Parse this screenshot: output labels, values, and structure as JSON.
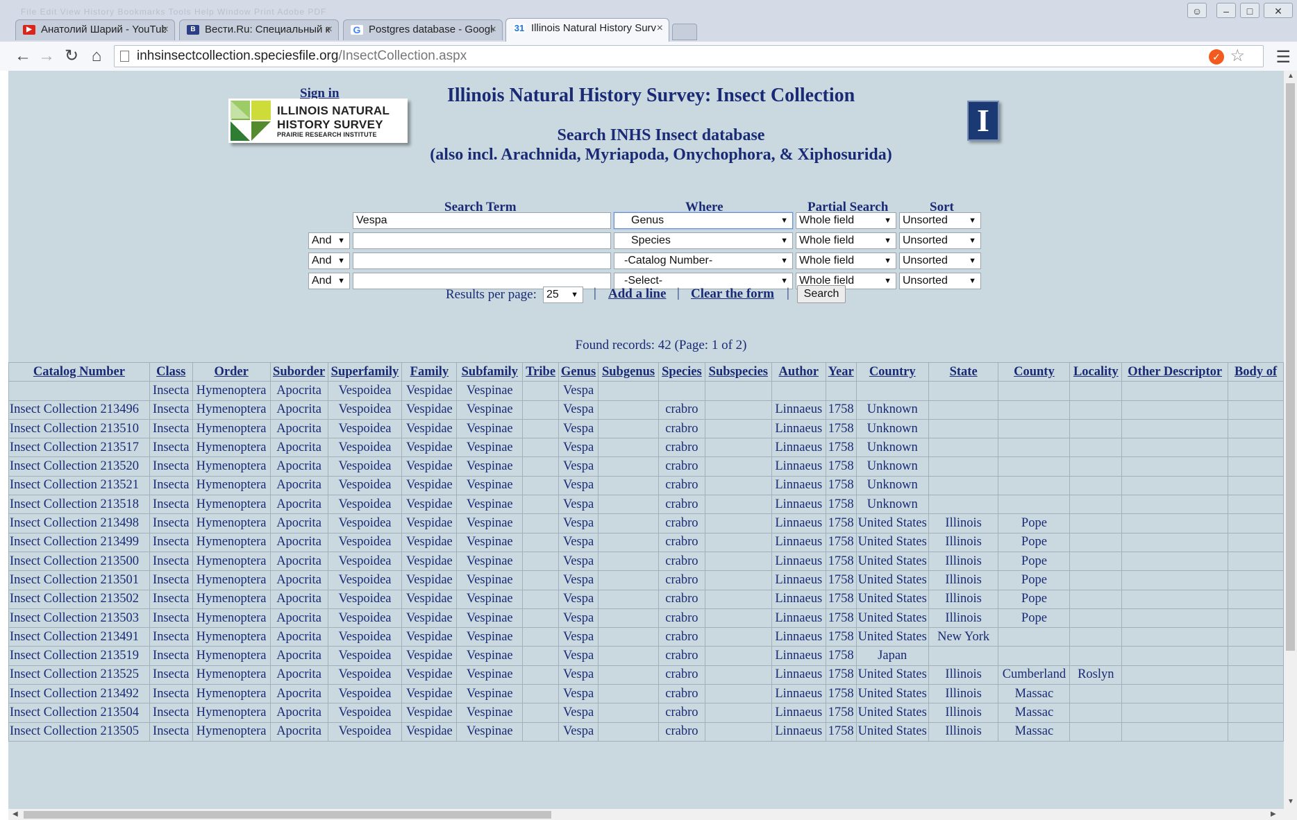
{
  "browser": {
    "menu_ghost": "File   Edit   View   History   Bookmarks   Tools   Help   Window   Print   Adobe PDF",
    "tabs": [
      {
        "title": "Анатолий Шарий - YouTube",
        "favicon": "youtube-icon",
        "color": "#d9251b"
      },
      {
        "title": "Вести.Ru: Специальный корреспондент",
        "favicon": "vesti-icon",
        "color": "#2b3e86"
      },
      {
        "title": "Postgres database - Google",
        "favicon": "google-icon",
        "color": "#4285f4"
      },
      {
        "title": "Illinois Natural History Survey",
        "favicon": "calendar-icon",
        "color": "#1a73e8"
      }
    ],
    "url_host": "inhsinsectcollection.speciesfile.org",
    "url_path": "/InsectCollection.aspx"
  },
  "page": {
    "sign_in": "Sign in",
    "title": "Illinois Natural History Survey: Insect Collection",
    "subtitle_line1": "Search INHS Insect database",
    "subtitle_line2": "(also incl. Arachnida, Myriapoda, Onychophora, & Xiphosurida)",
    "logo": {
      "line1": "ILLINOIS NATURAL",
      "line2": "HISTORY SURVEY",
      "line3": "PRAIRIE RESEARCH INSTITUTE"
    },
    "uiuc_logo": "I"
  },
  "search": {
    "headers": {
      "term": "Search Term",
      "where": "Where",
      "partial": "Partial Search",
      "sort": "Sort"
    },
    "rows": [
      {
        "conjunction": "",
        "term": "Vespa",
        "where": "Genus",
        "partial": "Whole field",
        "sort": "Unsorted"
      },
      {
        "conjunction": "And",
        "term": "",
        "where": "Species",
        "partial": "Whole field",
        "sort": "Unsorted"
      },
      {
        "conjunction": "And",
        "term": "",
        "where": "-Catalog Number-",
        "partial": "Whole field",
        "sort": "Unsorted"
      },
      {
        "conjunction": "And",
        "term": "",
        "where": "-Select-",
        "partial": "Whole field",
        "sort": "Unsorted"
      }
    ],
    "results_per_page_label": "Results per page:",
    "results_per_page": "25",
    "add_line": "Add a line",
    "clear_form": "Clear the form",
    "search_button": "Search",
    "found": "Found records: 42 (Page: 1 of 2)"
  },
  "results": {
    "columns": [
      "Catalog Number",
      "Class",
      "Order",
      "Suborder",
      "Superfamily",
      "Family",
      "Subfamily",
      "Tribe",
      "Genus",
      "Subgenus",
      "Species",
      "Subspecies",
      "Author",
      "Year",
      "Country",
      "State",
      "County",
      "Locality",
      "Other Descriptor",
      "Body of"
    ],
    "rows": [
      [
        "",
        "Insecta",
        "Hymenoptera",
        "Apocrita",
        "Vespoidea",
        "Vespidae",
        "Vespinae",
        "",
        "Vespa",
        "",
        "",
        "",
        "",
        "",
        "",
        "",
        "",
        "",
        "",
        ""
      ],
      [
        "Insect Collection 213496",
        "Insecta",
        "Hymenoptera",
        "Apocrita",
        "Vespoidea",
        "Vespidae",
        "Vespinae",
        "",
        "Vespa",
        "",
        "crabro",
        "",
        "Linnaeus",
        "1758",
        "Unknown",
        "",
        "",
        "",
        "",
        ""
      ],
      [
        "Insect Collection 213510",
        "Insecta",
        "Hymenoptera",
        "Apocrita",
        "Vespoidea",
        "Vespidae",
        "Vespinae",
        "",
        "Vespa",
        "",
        "crabro",
        "",
        "Linnaeus",
        "1758",
        "Unknown",
        "",
        "",
        "",
        "",
        ""
      ],
      [
        "Insect Collection 213517",
        "Insecta",
        "Hymenoptera",
        "Apocrita",
        "Vespoidea",
        "Vespidae",
        "Vespinae",
        "",
        "Vespa",
        "",
        "crabro",
        "",
        "Linnaeus",
        "1758",
        "Unknown",
        "",
        "",
        "",
        "",
        ""
      ],
      [
        "Insect Collection 213520",
        "Insecta",
        "Hymenoptera",
        "Apocrita",
        "Vespoidea",
        "Vespidae",
        "Vespinae",
        "",
        "Vespa",
        "",
        "crabro",
        "",
        "Linnaeus",
        "1758",
        "Unknown",
        "",
        "",
        "",
        "",
        ""
      ],
      [
        "Insect Collection 213521",
        "Insecta",
        "Hymenoptera",
        "Apocrita",
        "Vespoidea",
        "Vespidae",
        "Vespinae",
        "",
        "Vespa",
        "",
        "crabro",
        "",
        "Linnaeus",
        "1758",
        "Unknown",
        "",
        "",
        "",
        "",
        ""
      ],
      [
        "Insect Collection 213518",
        "Insecta",
        "Hymenoptera",
        "Apocrita",
        "Vespoidea",
        "Vespidae",
        "Vespinae",
        "",
        "Vespa",
        "",
        "crabro",
        "",
        "Linnaeus",
        "1758",
        "Unknown",
        "",
        "",
        "",
        "",
        ""
      ],
      [
        "Insect Collection 213498",
        "Insecta",
        "Hymenoptera",
        "Apocrita",
        "Vespoidea",
        "Vespidae",
        "Vespinae",
        "",
        "Vespa",
        "",
        "crabro",
        "",
        "Linnaeus",
        "1758",
        "United States",
        "Illinois",
        "Pope",
        "",
        "",
        ""
      ],
      [
        "Insect Collection 213499",
        "Insecta",
        "Hymenoptera",
        "Apocrita",
        "Vespoidea",
        "Vespidae",
        "Vespinae",
        "",
        "Vespa",
        "",
        "crabro",
        "",
        "Linnaeus",
        "1758",
        "United States",
        "Illinois",
        "Pope",
        "",
        "",
        ""
      ],
      [
        "Insect Collection 213500",
        "Insecta",
        "Hymenoptera",
        "Apocrita",
        "Vespoidea",
        "Vespidae",
        "Vespinae",
        "",
        "Vespa",
        "",
        "crabro",
        "",
        "Linnaeus",
        "1758",
        "United States",
        "Illinois",
        "Pope",
        "",
        "",
        ""
      ],
      [
        "Insect Collection 213501",
        "Insecta",
        "Hymenoptera",
        "Apocrita",
        "Vespoidea",
        "Vespidae",
        "Vespinae",
        "",
        "Vespa",
        "",
        "crabro",
        "",
        "Linnaeus",
        "1758",
        "United States",
        "Illinois",
        "Pope",
        "",
        "",
        ""
      ],
      [
        "Insect Collection 213502",
        "Insecta",
        "Hymenoptera",
        "Apocrita",
        "Vespoidea",
        "Vespidae",
        "Vespinae",
        "",
        "Vespa",
        "",
        "crabro",
        "",
        "Linnaeus",
        "1758",
        "United States",
        "Illinois",
        "Pope",
        "",
        "",
        ""
      ],
      [
        "Insect Collection 213503",
        "Insecta",
        "Hymenoptera",
        "Apocrita",
        "Vespoidea",
        "Vespidae",
        "Vespinae",
        "",
        "Vespa",
        "",
        "crabro",
        "",
        "Linnaeus",
        "1758",
        "United States",
        "Illinois",
        "Pope",
        "",
        "",
        ""
      ],
      [
        "Insect Collection 213491",
        "Insecta",
        "Hymenoptera",
        "Apocrita",
        "Vespoidea",
        "Vespidae",
        "Vespinae",
        "",
        "Vespa",
        "",
        "crabro",
        "",
        "Linnaeus",
        "1758",
        "United States",
        "New York",
        "",
        "",
        "",
        ""
      ],
      [
        "Insect Collection 213519",
        "Insecta",
        "Hymenoptera",
        "Apocrita",
        "Vespoidea",
        "Vespidae",
        "Vespinae",
        "",
        "Vespa",
        "",
        "crabro",
        "",
        "Linnaeus",
        "1758",
        "Japan",
        "",
        "",
        "",
        "",
        ""
      ],
      [
        "Insect Collection 213525",
        "Insecta",
        "Hymenoptera",
        "Apocrita",
        "Vespoidea",
        "Vespidae",
        "Vespinae",
        "",
        "Vespa",
        "",
        "crabro",
        "",
        "Linnaeus",
        "1758",
        "United States",
        "Illinois",
        "Cumberland",
        "Roslyn",
        "",
        ""
      ],
      [
        "Insect Collection 213492",
        "Insecta",
        "Hymenoptera",
        "Apocrita",
        "Vespoidea",
        "Vespidae",
        "Vespinae",
        "",
        "Vespa",
        "",
        "crabro",
        "",
        "Linnaeus",
        "1758",
        "United States",
        "Illinois",
        "Massac",
        "",
        "",
        ""
      ],
      [
        "Insect Collection 213504",
        "Insecta",
        "Hymenoptera",
        "Apocrita",
        "Vespoidea",
        "Vespidae",
        "Vespinae",
        "",
        "Vespa",
        "",
        "crabro",
        "",
        "Linnaeus",
        "1758",
        "United States",
        "Illinois",
        "Massac",
        "",
        "",
        ""
      ],
      [
        "Insect Collection 213505",
        "Insecta",
        "Hymenoptera",
        "Apocrita",
        "Vespoidea",
        "Vespidae",
        "Vespinae",
        "",
        "Vespa",
        "",
        "crabro",
        "",
        "Linnaeus",
        "1758",
        "United States",
        "Illinois",
        "Massac",
        "",
        "",
        ""
      ]
    ]
  }
}
